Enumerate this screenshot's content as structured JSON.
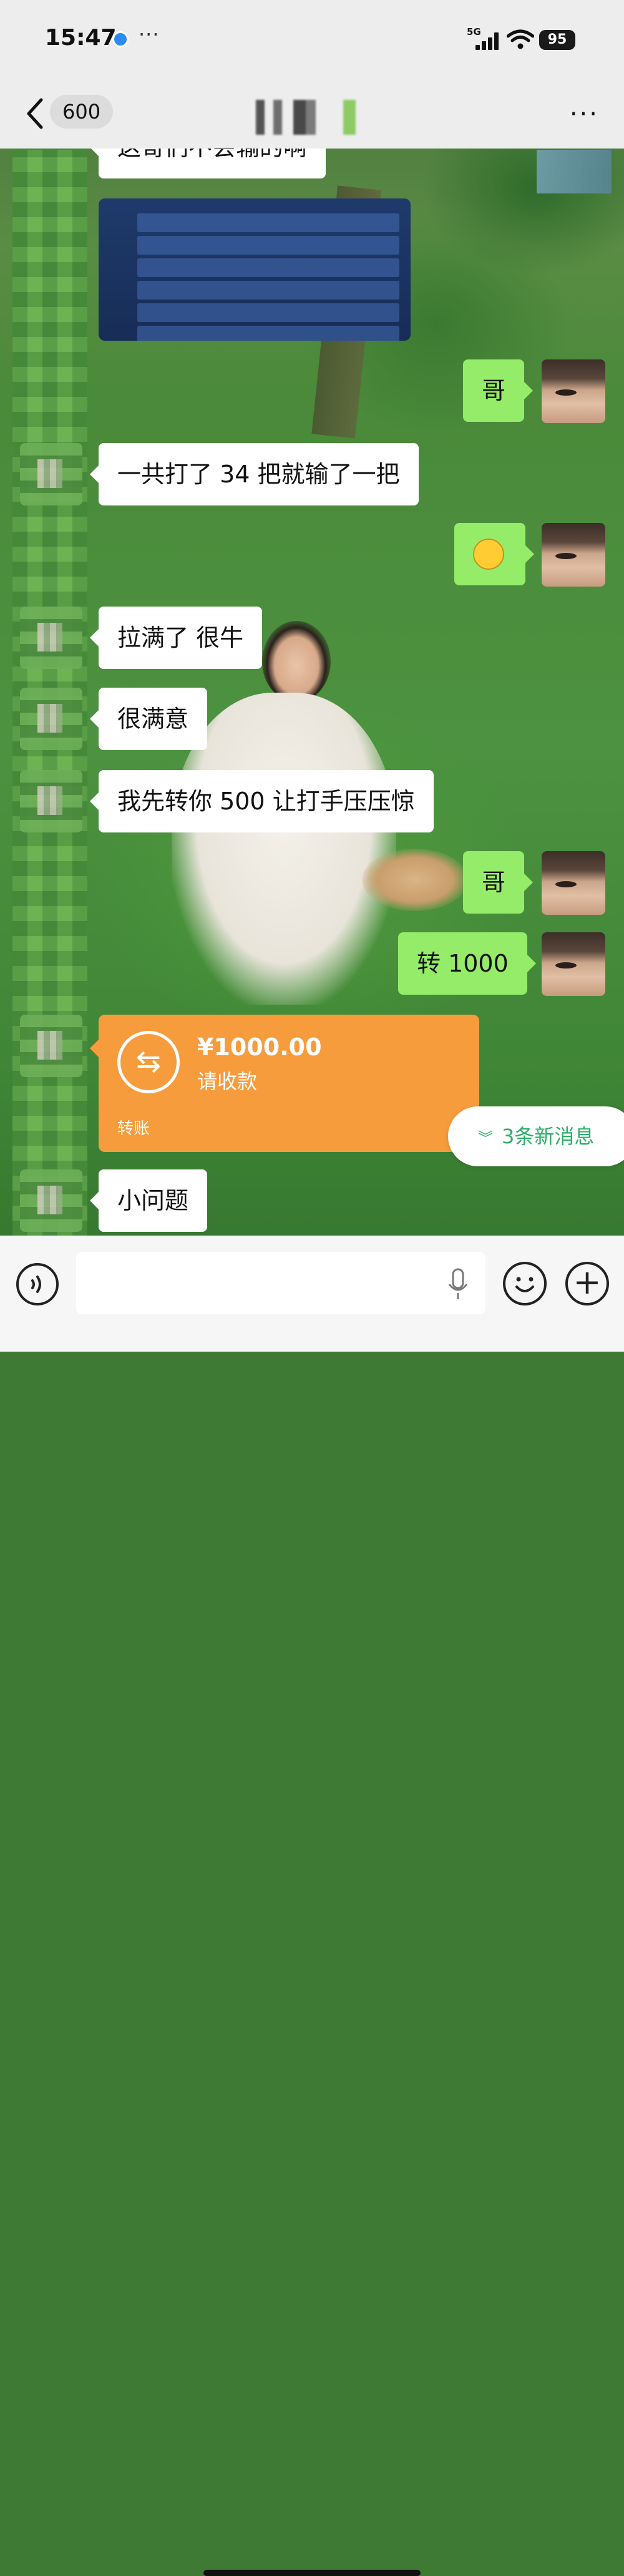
{
  "status_bar": {
    "time": "15:47",
    "network": "5G",
    "battery": "95",
    "icons": [
      "app-notification-icon",
      "signal-icon",
      "wifi-icon",
      "battery-icon"
    ]
  },
  "header": {
    "unread_count": "600",
    "title": "",
    "icons": [
      "back-chevron-icon",
      "more-options-icon"
    ]
  },
  "messages": [
    {
      "side": "left",
      "type": "text",
      "text": "这哥们不会输的啊"
    },
    {
      "side": "left",
      "type": "image",
      "description": "game-record-screenshot"
    },
    {
      "side": "right",
      "type": "text",
      "text": "哥"
    },
    {
      "side": "left",
      "type": "text",
      "text": "一共打了 34 把就输了一把"
    },
    {
      "side": "right",
      "type": "emoji",
      "icon": "grin-emoji-icon"
    },
    {
      "side": "left",
      "type": "text",
      "text": "拉满了 很牛"
    },
    {
      "side": "left",
      "type": "text",
      "text": "很满意"
    },
    {
      "side": "left",
      "type": "text",
      "text": "我先转你 500 让打手压压惊"
    },
    {
      "side": "right",
      "type": "text",
      "text": "哥"
    },
    {
      "side": "right",
      "type": "text",
      "text": "转 1000"
    },
    {
      "side": "left",
      "type": "transfer",
      "amount": "¥1000.00",
      "status": "请收款",
      "label": "转账"
    },
    {
      "side": "left",
      "type": "text",
      "text": "小问题"
    }
  ],
  "new_messages": {
    "label": "3条新消息",
    "icon": "double-chevron-down-icon"
  },
  "input_bar": {
    "icons": [
      "voice-toggle-icon",
      "microphone-icon",
      "emoji-icon",
      "plus-icon"
    ]
  },
  "colors": {
    "bubble_self": "#95ec69",
    "bubble_other": "#ffffff",
    "transfer": "#f79c3c",
    "accent_green": "#2aae67"
  }
}
